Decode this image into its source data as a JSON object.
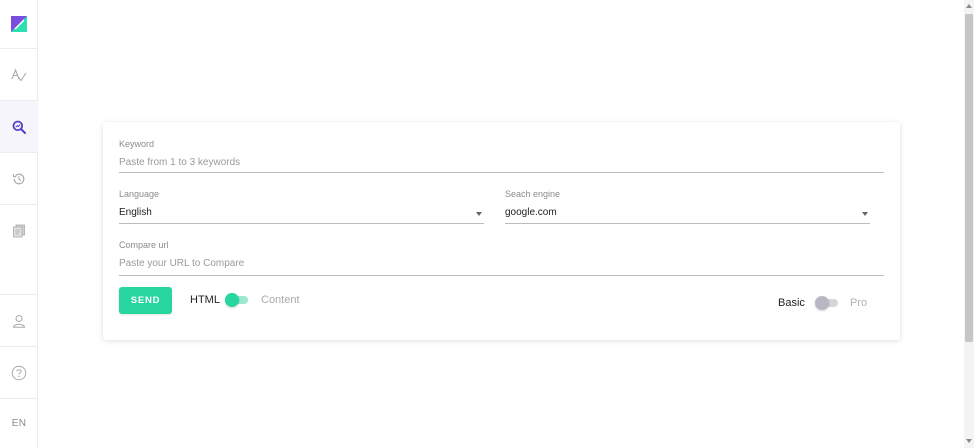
{
  "sidebar": {
    "items": [
      {
        "name": "logo",
        "icon": "app-logo"
      },
      {
        "name": "spellcheck",
        "icon": "spellcheck-icon"
      },
      {
        "name": "search",
        "icon": "search-analytics-icon",
        "active": true
      },
      {
        "name": "history",
        "icon": "history-icon"
      },
      {
        "name": "documents",
        "icon": "documents-icon"
      },
      {
        "name": "profile",
        "icon": "user-icon"
      },
      {
        "name": "help",
        "icon": "help-icon"
      }
    ],
    "language": "EN"
  },
  "form": {
    "keyword": {
      "label": "Keyword",
      "placeholder": "Paste from 1 to 3 keywords"
    },
    "language": {
      "label": "Language",
      "value": "English"
    },
    "search_engine": {
      "label": "Seach engine",
      "value": "google.com"
    },
    "compare_url": {
      "label": "Compare url",
      "placeholder": "Paste your URL to Compare"
    },
    "send_label": "SEND",
    "format_toggle": {
      "left": "HTML",
      "right": "Content",
      "on": true
    },
    "mode_toggle": {
      "left": "Basic",
      "right": "Pro",
      "on": false
    }
  },
  "colors": {
    "accent": "#27d59e",
    "logo_purple": "#7b4ddf",
    "logo_teal": "#2ee0b0",
    "active_icon": "#5b3fc4",
    "muted_icon": "#b0b0b0"
  }
}
